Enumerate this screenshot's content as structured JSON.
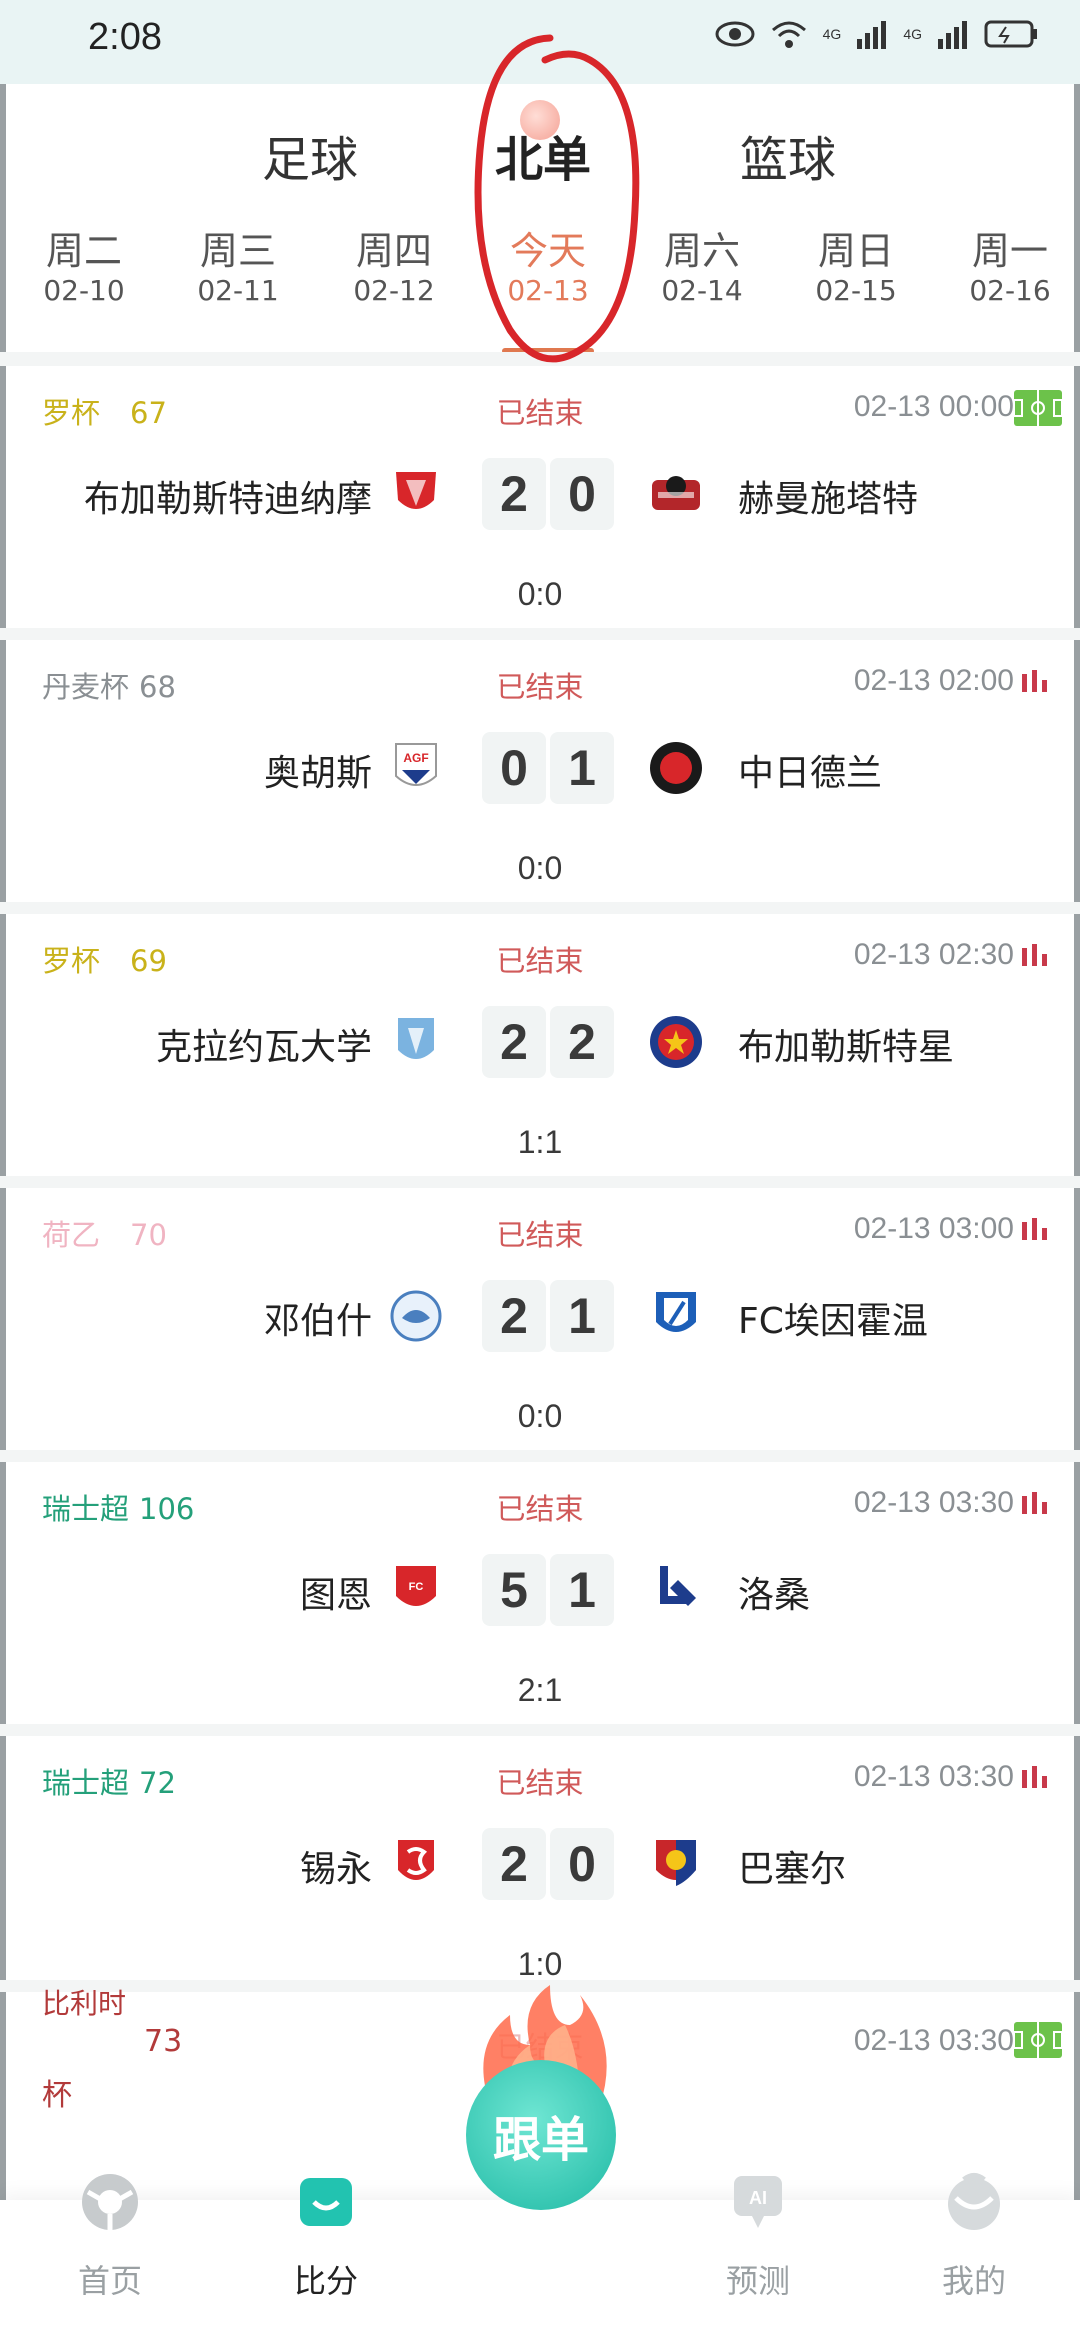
{
  "status_bar": {
    "time": "2:08",
    "network1": "4G",
    "network2": "4G"
  },
  "tabs": {
    "football": "足球",
    "beidan": "北单",
    "basketball": "篮球",
    "active": "beidan"
  },
  "dates": [
    {
      "weekday": "周二",
      "date": "02-10"
    },
    {
      "weekday": "周三",
      "date": "02-11"
    },
    {
      "weekday": "周四",
      "date": "02-12"
    },
    {
      "weekday": "今天",
      "date": "02-13"
    },
    {
      "weekday": "周六",
      "date": "02-14"
    },
    {
      "weekday": "周日",
      "date": "02-15"
    },
    {
      "weekday": "周一",
      "date": "02-16"
    }
  ],
  "matches": [
    {
      "league": "罗杯",
      "num": "67",
      "league_color": "#c9b21a",
      "status": "已结束",
      "time": "02-13 00:00",
      "home": "布加勒斯特迪纳摩",
      "away": "赫曼施塔特",
      "score_home": "2",
      "score_away": "0",
      "halftime": "0:0",
      "icon": "pitch-icon"
    },
    {
      "league": "丹麦杯",
      "num": "68",
      "league_color": "#8a8f93",
      "status": "已结束",
      "time": "02-13 02:00",
      "home": "奥胡斯",
      "away": "中日德兰",
      "score_home": "0",
      "score_away": "1",
      "halftime": "0:0",
      "icon": "stats-icon"
    },
    {
      "league": "罗杯",
      "num": "69",
      "league_color": "#c9b21a",
      "status": "已结束",
      "time": "02-13 02:30",
      "home": "克拉约瓦大学",
      "away": "布加勒斯特星",
      "score_home": "2",
      "score_away": "2",
      "halftime": "1:1",
      "icon": "stats-icon"
    },
    {
      "league": "荷乙",
      "num": "70",
      "league_color": "#f0b4c2",
      "status": "已结束",
      "time": "02-13 03:00",
      "home": "邓伯什",
      "away": "FC埃因霍温",
      "score_home": "2",
      "score_away": "1",
      "halftime": "0:0",
      "icon": "stats-icon"
    },
    {
      "league": "瑞士超",
      "num": "106",
      "league_color": "#24a07a",
      "status": "已结束",
      "time": "02-13 03:30",
      "home": "图恩",
      "away": "洛桑",
      "score_home": "5",
      "score_away": "1",
      "halftime": "2:1",
      "icon": "stats-icon"
    },
    {
      "league": "瑞士超",
      "num": "72",
      "league_color": "#24a07a",
      "status": "已结束",
      "time": "02-13 03:30",
      "home": "锡永",
      "away": "巴塞尔",
      "score_home": "2",
      "score_away": "0",
      "halftime": "1:0",
      "icon": "stats-icon"
    }
  ],
  "partial_match": {
    "league_top": "比利时",
    "num": "73",
    "league_bottom": "杯",
    "status": "已结束",
    "time": "02-13 03:30"
  },
  "bottom_nav": {
    "home": "首页",
    "score": "比分",
    "follow": "跟单",
    "predict": "预测",
    "mine": "我的",
    "ai_badge": "AI"
  },
  "colors": {
    "accent": "#e0784f",
    "status_red": "#d05a5a",
    "teal": "#1fb9a4",
    "annotation_red": "#d8262a"
  }
}
